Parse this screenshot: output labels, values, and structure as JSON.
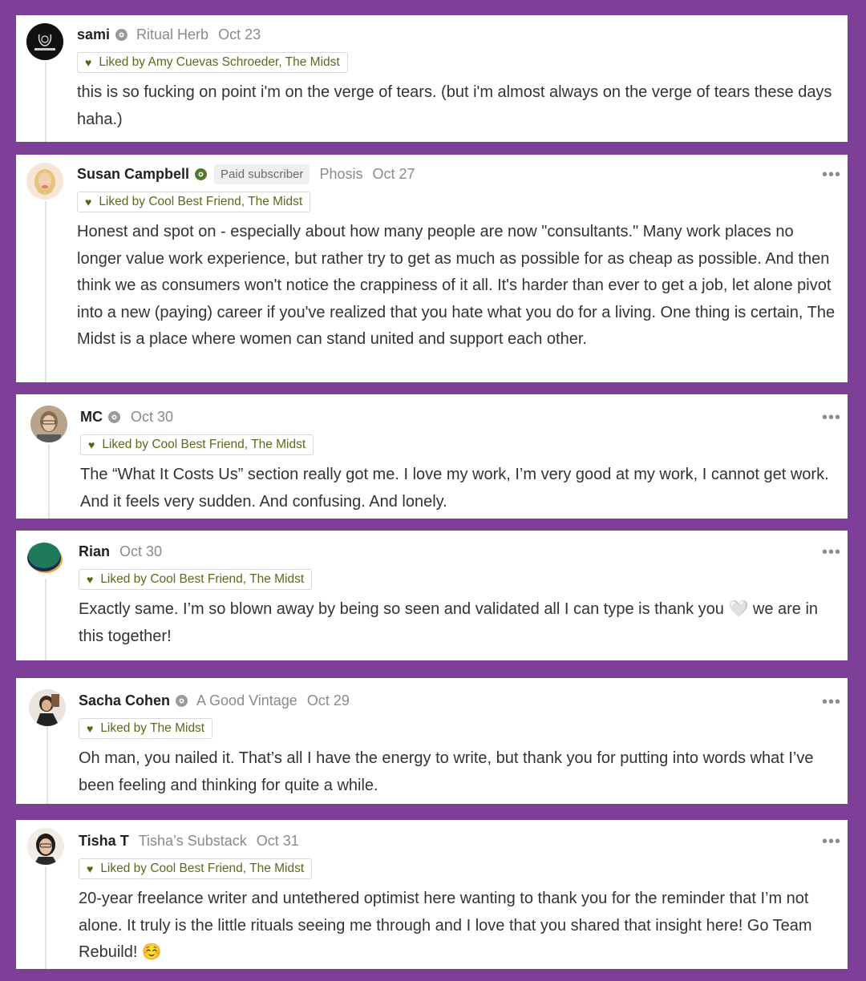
{
  "colors": {
    "background": "#7e3f98",
    "liked_text": "#5b6b1a",
    "heart": "#4e6b12"
  },
  "comments": [
    {
      "name": "sami",
      "publication": "Ritual Herb",
      "date": "Oct 23",
      "paid_label": "",
      "liked": "Liked by Amy Cuevas Schroeder, The Midst",
      "text": "this is so fucking on point i'm on the verge of tears. (but i'm almost always on the verge of tears these days haha.)"
    },
    {
      "name": "Susan Campbell",
      "publication": "Phosis",
      "date": "Oct 27",
      "paid_label": "Paid subscriber",
      "liked": "Liked by Cool Best Friend, The Midst",
      "text": "Honest and spot on - especially about how many people are now \"consultants.\" Many work places no longer value work experience, but rather try to get as much as possible for as cheap as possible. And then think we as consumers won't notice the crappiness of it all. It's harder than ever to get a job, let alone pivot into a new (paying) career if you've realized that you hate what you do for a living. One thing is certain, The Midst is a place where women can stand united and support each other."
    },
    {
      "name": "MC",
      "publication": "",
      "date": "Oct 30",
      "paid_label": "",
      "liked": "Liked by Cool Best Friend, The Midst",
      "text": "The “What It Costs Us” section really got me. I love my work, I’m very good at my work, I cannot get work. And it feels very sudden. And confusing. And lonely."
    },
    {
      "name": "Rian",
      "publication": "",
      "date": "Oct 30",
      "paid_label": "",
      "liked": "Liked by Cool Best Friend, The Midst",
      "text": "Exactly same. I’m so blown away by being so seen and validated all I can type is thank you 🤍 we are in this together!"
    },
    {
      "name": "Sacha Cohen",
      "publication": "A Good Vintage",
      "date": "Oct 29",
      "paid_label": "",
      "liked": "Liked by The Midst",
      "text": "Oh man, you nailed it. That’s all I have the energy to write, but thank you for putting into words what I’ve been feeling and thinking for quite a while."
    },
    {
      "name": "Tisha T",
      "publication": "Tisha’s Substack",
      "date": "Oct 31",
      "paid_label": "",
      "liked": "Liked by Cool Best Friend, The Midst",
      "text": "20-year freelance writer and untethered optimist here wanting to thank you for the reminder that I’m not alone. It truly is the little rituals seeing me through and I love that you shared that insight here! Go Team Rebuild! ☺️"
    }
  ]
}
